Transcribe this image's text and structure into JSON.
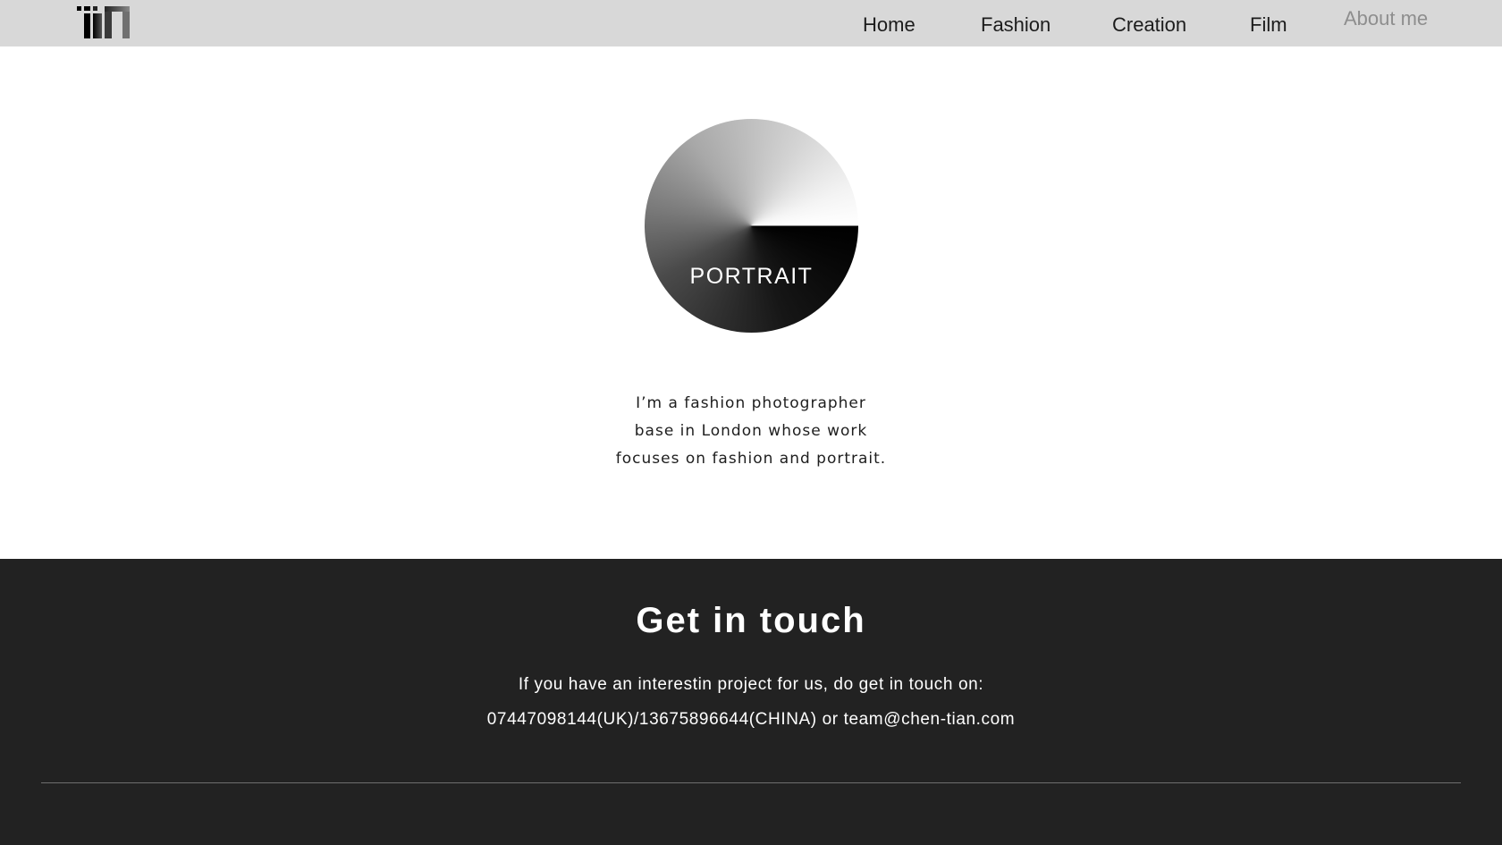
{
  "header": {
    "logo_icon": "tian-logo-icon",
    "nav": [
      {
        "label": "Home"
      },
      {
        "label": "Fashion"
      },
      {
        "label": "Creation"
      },
      {
        "label": "Film"
      },
      {
        "label": "About me",
        "active": true
      }
    ]
  },
  "main": {
    "portrait_card": {
      "label": "PORTRAIT"
    },
    "intro_lines": [
      "I’m a fashion photographer",
      "base in London whose work",
      "focuses on fashion and portrait."
    ]
  },
  "footer": {
    "title": "Get in touch",
    "line1": "If you have an interestin project for us, do get in touch on:",
    "line2": "07447098144(UK)/13675896644(CHINA) or team@chen-tian.com"
  },
  "colors": {
    "topbar_bg": "#d8d8d8",
    "footer_bg": "#222222",
    "nav_active": "#8e8e8e",
    "text_dark": "#1c1c1c"
  }
}
